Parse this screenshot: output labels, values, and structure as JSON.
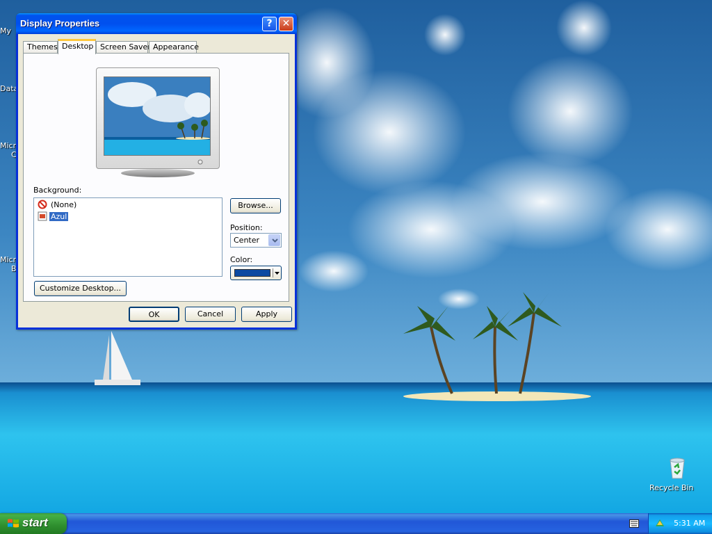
{
  "window": {
    "title": "Display Properties",
    "help_glyph": "?",
    "close_glyph": "✕"
  },
  "tabs": [
    {
      "label": "Themes"
    },
    {
      "label": "Desktop",
      "active": true
    },
    {
      "label": "Screen Saver"
    },
    {
      "label": "Appearance"
    }
  ],
  "desktop_tab": {
    "background_label": "Background:",
    "background_items": [
      {
        "label": "(None)",
        "icon": "none-icon"
      },
      {
        "label": "Azul",
        "icon": "image-file-icon",
        "selected": true
      }
    ],
    "browse_label": "Browse...",
    "position_label": "Position:",
    "position_value": "Center",
    "color_label": "Color:",
    "color_value": "#0b4aa2",
    "customize_label": "Customize Desktop..."
  },
  "buttons": {
    "ok": "OK",
    "cancel": "Cancel",
    "apply": "Apply"
  },
  "desktop_icons": {
    "recycle_bin": "Recycle Bin",
    "left_labels": [
      "My",
      "Data",
      "Micro",
      "C",
      "Micro",
      "B"
    ]
  },
  "taskbar": {
    "start_label": "start",
    "clock": "5:31 AM"
  },
  "colors": {
    "title_bar": "#0053ee",
    "window_frame": "#0831d9",
    "taskbar": "#2157d7",
    "start_button": "#2f8f2f",
    "tray": "#18b9ff",
    "selection": "#316ac5"
  }
}
